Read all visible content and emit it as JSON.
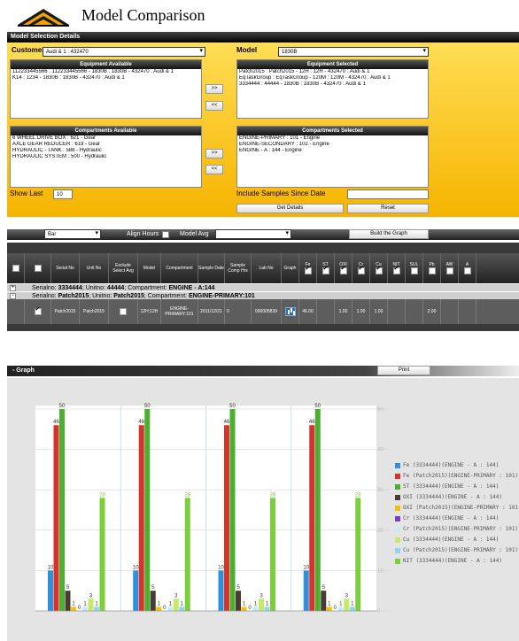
{
  "header": {
    "title": "Model Comparison"
  },
  "selection": {
    "panel_title": "Model Selection Details",
    "customer_label": "Customer",
    "customer_value": "Audi & 1 : 432470",
    "model_label": "Model",
    "model_value": "1830B",
    "equipment_available_title": "Equipment Available",
    "equipment_available": [
      "112233445566 : 112233445566 - 1830B : 1830B - 432470 : Audi & 1",
      "K14 : 1234 - 1830B : 1830B - 432470 : Audi & 1"
    ],
    "equipment_selected_title": "Equipment Selected",
    "equipment_selected": [
      "Patch2015 : Patch2015 - 12H : 12H - 432470 : Audi & 1",
      "EqTaskGroup : EqTaskGroup - 120M : 120M - 432470 : Audi & 1",
      "3334444 : 44444 - 1830B : 1830B - 432470 : Audi & 1"
    ],
    "compartments_available_title": "Compartments Available",
    "compartments_available": [
      "6 WHEEL DRIVE BOX : 621 - Gear",
      "AXLE GEAR REDUCER : 619 - Gear",
      "HYDRAULIC - TANK : 588 - Hydraulic",
      "HYDRAULIC SYSTEM : 500 - Hydraulic"
    ],
    "compartments_selected_title": "Compartments Selected",
    "compartments_selected": [
      "ENGINE-PRIMARY : 101 - Engine",
      "ENGINE-SECONDARY : 102 - Engine",
      "ENGINE - A : 144 - Engine"
    ],
    "move_right_label": ">>",
    "move_left_label": "<<",
    "show_last_label": "Show Last",
    "show_last_value": "10",
    "include_samples_label": "Include Samples Since Date",
    "include_samples_value": "",
    "get_details_label": "Get Details",
    "reset_label": "Reset"
  },
  "graph_options": {
    "graph_type_value": "Bar",
    "align_hours_label": "Align Hours",
    "model_avg_label": "Model Avg",
    "model_avg_value": "",
    "build_graph_label": "Build the Graph"
  },
  "table": {
    "columns": [
      "Serial No",
      "Unit No",
      "Exclude Select Avg",
      "Model",
      "Compartment",
      "Sample Date",
      "Sample Comp Hrs",
      "Lab No",
      "Graph",
      "Fe",
      "ST",
      "OXI",
      "Cr",
      "Cu",
      "NIT",
      "SUL",
      "Pb",
      "AW",
      "A"
    ],
    "group1_prefix": "Serialno: ",
    "group1_serial": "3334444",
    "group1_mid1": "; Unitno: ",
    "group1_unit": "44444",
    "group1_mid2": "; Compartment: ",
    "group1_comp": "ENGINE - A:144",
    "group2_prefix": "Serialno: ",
    "group2_serial": "Patch2015",
    "group2_mid1": "; Unitno: ",
    "group2_unit": "Patch2015",
    "group2_mid2": "; Compartment: ",
    "group2_comp": "ENGINE-PRIMARY:101",
    "row": {
      "serial": "Patch2015",
      "unit": "Patch2015",
      "model": "12H:12H",
      "compartment": "ENGINE-PRIMARY:101",
      "sample_date": "2011/12/21",
      "comp_hrs": "0",
      "lab_no": "000005839",
      "fe": "46.00",
      "oxi": "1.00",
      "cr": "1.00",
      "cu": "1.00",
      "pb": "2.00"
    }
  },
  "graph_panel": {
    "title": "- Graph",
    "print_label": "Print"
  },
  "chart_data": {
    "type": "bar",
    "groups": 4,
    "ylim": [
      0,
      50
    ],
    "y_ticks": [
      "50",
      "40",
      "30",
      "20",
      "10",
      "0"
    ],
    "series": [
      {
        "name": "Fe (3334444)(ENGINE - A : 144)",
        "color": "#2f8fd8",
        "values": [
          10,
          10,
          10,
          10
        ]
      },
      {
        "name": "Fe (Patch2015)(ENGINE-PRIMARY : 101)",
        "color": "#d9312b",
        "values": [
          46,
          46,
          46,
          46
        ]
      },
      {
        "name": "ST (3334444)(ENGINE - A : 144)",
        "color": "#4caf2f",
        "values": [
          50,
          50,
          50,
          50
        ]
      },
      {
        "name": "OXI (3334444)(ENGINE - A : 144)",
        "color": "#4a3b36",
        "values": [
          5,
          5,
          5,
          5
        ]
      },
      {
        "name": "OXI (Patch2015)(ENGINE-PRIMARY : 101)",
        "color": "#f2c200",
        "values": [
          1,
          1,
          1,
          1
        ]
      },
      {
        "name": "Cr (3334444)(ENGINE - A : 144)",
        "color": "#7a3fc0",
        "values": [
          0,
          0,
          0,
          0
        ]
      },
      {
        "name": "Cr (Patch2015)(ENGINE-PRIMARY : 101)",
        "color": "#c9e8f8",
        "values": [
          1,
          1,
          1,
          1
        ]
      },
      {
        "name": "Cu (3334444)(ENGINE - A : 144)",
        "color": "#c8e86a",
        "values": [
          3,
          3,
          3,
          3
        ]
      },
      {
        "name": "Cu (Patch2015)(ENGINE-PRIMARY : 101)",
        "color": "#8fd4f4",
        "values": [
          1,
          1,
          1,
          1
        ]
      },
      {
        "name": "NIT (3334444)(ENGINE - A : 144)",
        "color": "#7cce3a",
        "values": [
          28,
          28,
          28,
          28
        ]
      }
    ],
    "legend_position": "right"
  }
}
